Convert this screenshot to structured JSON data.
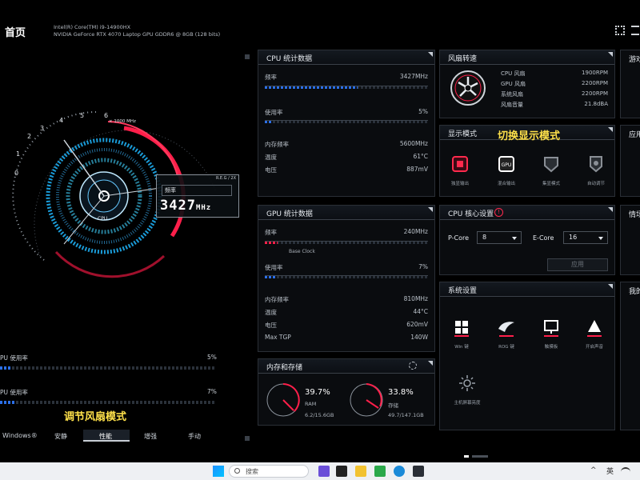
{
  "header": {
    "title": "首页",
    "cpu_name": "Intel(R) Core(TM) i9-14900HX",
    "gpu_name": "NVIDIA GeForce RTX 4070 Laptop GPU GDDR6 @ 8GB (128 bits)"
  },
  "gauge": {
    "scale_labels": [
      "0",
      "1",
      "2",
      "3",
      "4",
      "5",
      "6"
    ],
    "unit_label": "× 1000 MHz",
    "center_label": "CPU",
    "readout_label": "频率",
    "readout_tag": "R.E.G / 2X",
    "readout_value": "3427",
    "readout_unit": "MHz",
    "frequency_mhz": 3427
  },
  "left_usage": [
    {
      "label": "PU 使用率",
      "value": "5%",
      "fill": 0.05
    },
    {
      "label": "PU 使用率",
      "value": "7%",
      "fill": 0.07
    }
  ],
  "fan_annotation": "调节风扇模式",
  "modes": {
    "items": [
      "Windows®",
      "安静",
      "性能",
      "增强",
      "手动"
    ],
    "active": "性能"
  },
  "cpu_stats": {
    "title": "CPU 统计数据",
    "freq_label": "频率",
    "freq_value": "3427MHz",
    "freq_fill": 0.57,
    "usage_label": "使用率",
    "usage_value": "5%",
    "usage_fill": 0.05,
    "mem_freq_label": "内存频率",
    "mem_freq_value": "5600MHz",
    "temp_label": "温度",
    "temp_value": "61°C",
    "volt_label": "电压",
    "volt_value": "887mV"
  },
  "gpu_stats": {
    "title": "GPU 统计数据",
    "freq_label": "频率",
    "freq_value": "240MHz",
    "freq_fill": 0.08,
    "base_clock": "Base Clock",
    "usage_label": "使用率",
    "usage_value": "7%",
    "usage_fill": 0.07,
    "mem_freq_label": "内存频率",
    "mem_freq_value": "810MHz",
    "temp_label": "温度",
    "temp_value": "44°C",
    "volt_label": "电压",
    "volt_value": "620mV",
    "tgp_label": "Max TGP",
    "tgp_value": "140W"
  },
  "memory": {
    "title": "内存和存储",
    "ram_percent": "39.7%",
    "ram_label": "RAM",
    "ram_detail": "6.2/15.6GB",
    "ram_fill": 0.397,
    "storage_percent": "33.8%",
    "storage_label": "存储",
    "storage_detail": "49.7/147.1GB",
    "storage_fill": 0.338
  },
  "fan_speed": {
    "title": "风扇转速",
    "rows": [
      {
        "label": "CPU 风扇",
        "value": "1900RPM"
      },
      {
        "label": "GPU 风扇",
        "value": "2200RPM"
      },
      {
        "label": "系统风扇",
        "value": "2200RPM"
      },
      {
        "label": "风扇音量",
        "value": "21.8dBA"
      }
    ]
  },
  "display_mode": {
    "title": "显示模式",
    "annotation": "切换显示模式",
    "items": [
      {
        "label": "独显输出",
        "icon": "chip-icon",
        "color": "#ff2a4d"
      },
      {
        "label": "混合输出",
        "icon": "gpu-icon",
        "color": "#ffffff"
      },
      {
        "label": "集显模式",
        "icon": "shield-icon",
        "color": "#8a8f96"
      },
      {
        "label": "自动调节",
        "icon": "auto-icon",
        "color": "#8a8f96"
      }
    ]
  },
  "cpu_core": {
    "title": "CPU 核心设置",
    "p_core_label": "P-Core",
    "p_core_value": "8",
    "e_core_label": "E-Core",
    "e_core_value": "16",
    "apply_label": "应用"
  },
  "system_settings": {
    "title": "系统设置",
    "items": [
      {
        "label": "Win 键",
        "icon": "windows-icon"
      },
      {
        "label": "ROG 键",
        "icon": "rog-icon"
      },
      {
        "label": "触摸板",
        "icon": "touchpad-icon"
      },
      {
        "label": "开启声音",
        "icon": "sound-icon"
      }
    ],
    "extra_label": "主机屏幕亮度"
  },
  "right_edge": {
    "labels": [
      "游戏",
      "应用",
      "情场",
      "我的"
    ]
  },
  "taskbar": {
    "search_placeholder": "搜索",
    "lang": "英"
  },
  "colors": {
    "accent_red": "#ff1f4a",
    "accent_blue": "#2b6fe8",
    "accent_cyan": "#3fd2ff",
    "annotation": "#ffe14a"
  }
}
